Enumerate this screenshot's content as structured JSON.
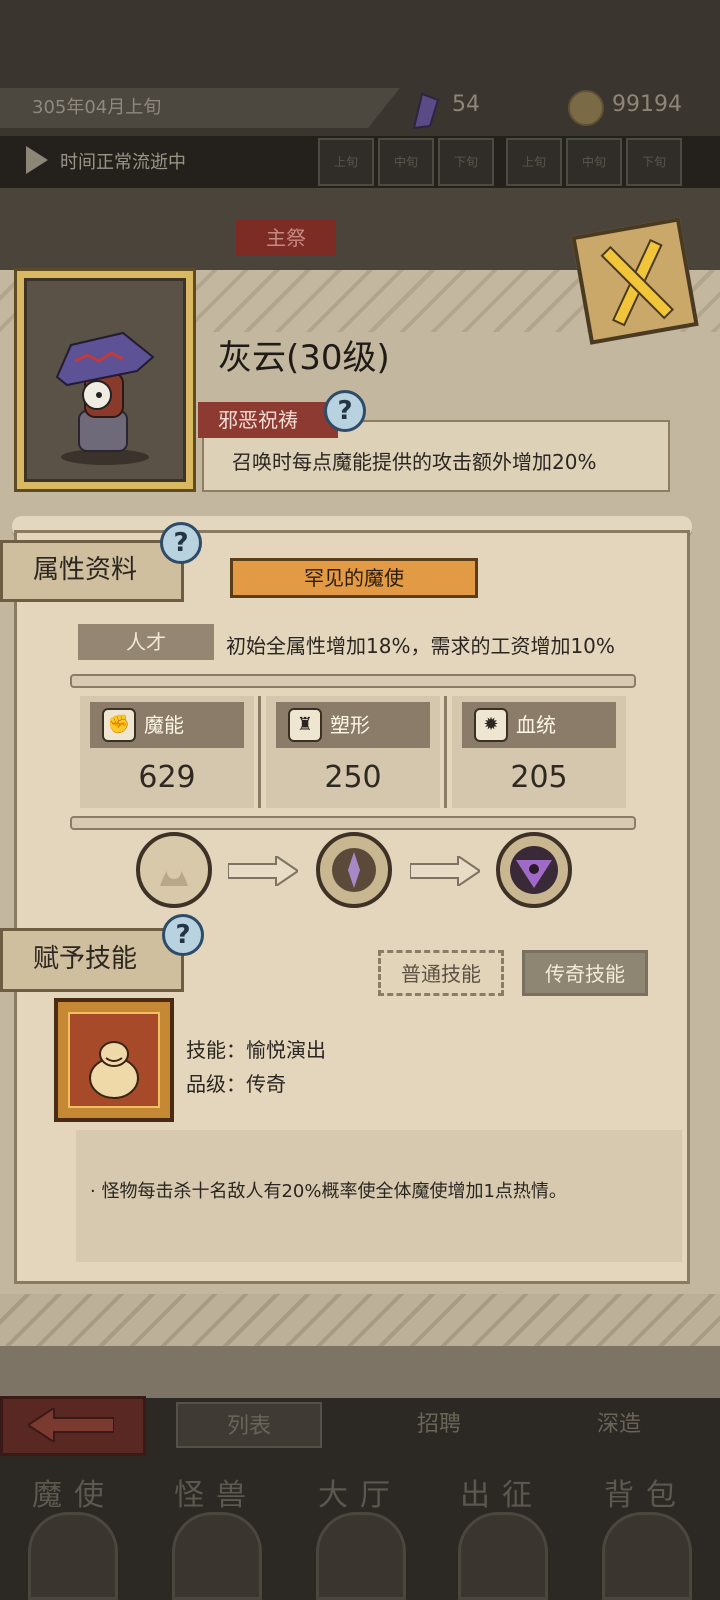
{
  "topbar": {
    "date": "305年04月上旬",
    "crystals": "54",
    "coins": "99194",
    "time_status": "时间正常流逝中",
    "periods": [
      "上旬",
      "中旬",
      "下旬",
      "上旬",
      "中旬",
      "下旬"
    ]
  },
  "tab_main": "主祭",
  "hero": {
    "name": "灰云(30级)",
    "trait_name": "邪恶祝祷",
    "trait_desc": "召唤时每点魔能提供的攻击额外增加20%"
  },
  "attributes": {
    "section_title": "属性资料",
    "rarity": "罕见的魔使",
    "talent_label": "人才",
    "talent_desc": "初始全属性增加18%，需求的工资增加10%",
    "stats": [
      {
        "label": "魔能",
        "value": "629",
        "icon": "magic-icon"
      },
      {
        "label": "塑形",
        "value": "250",
        "icon": "shape-icon"
      },
      {
        "label": "血统",
        "value": "205",
        "icon": "blood-icon"
      }
    ]
  },
  "skills": {
    "section_title": "赋予技能",
    "tab_normal": "普通技能",
    "tab_legend": "传奇技能",
    "skill_line": "技能：愉悦演出",
    "grade_line": "品级：传奇",
    "description": "·    怪物每击杀十名敌人有20%概率使全体魔使增加1点热情。"
  },
  "subtabs": [
    "列表",
    "招聘",
    "深造"
  ],
  "main_nav": [
    "魔使",
    "怪兽",
    "大厅",
    "出征",
    "背包"
  ],
  "colors": {
    "accent_orange": "#e39a45",
    "trait_red": "#8d3a32",
    "help_blue": "#b9d2e0"
  }
}
